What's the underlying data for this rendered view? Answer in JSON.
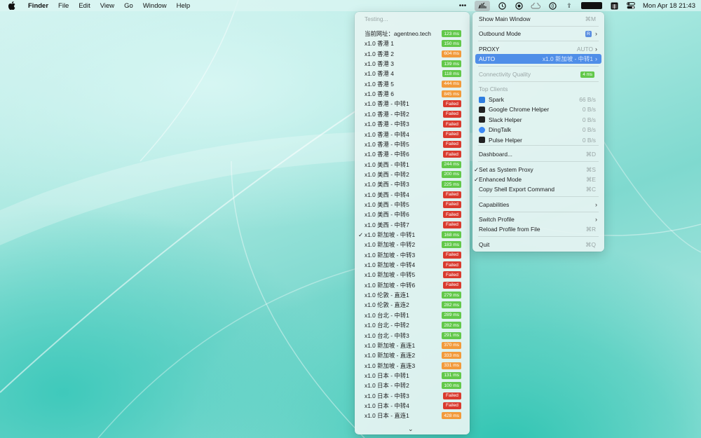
{
  "menubar": {
    "app_name": "Finder",
    "items": [
      "File",
      "Edit",
      "View",
      "Go",
      "Window",
      "Help"
    ],
    "clock": "Mon Apr 18  21:43"
  },
  "server_menu": {
    "header": "Testing...",
    "rows": [
      {
        "name": "当前网址：agentneo.tech",
        "latency": "123 ms",
        "status": "green"
      },
      {
        "name": "x1.0 香港 1",
        "latency": "150 ms",
        "status": "green"
      },
      {
        "name": "x1.0 香港 2",
        "latency": "604 ms",
        "status": "orange"
      },
      {
        "name": "x1.0 香港 3",
        "latency": "139 ms",
        "status": "green"
      },
      {
        "name": "x1.0 香港 4",
        "latency": "118 ms",
        "status": "green"
      },
      {
        "name": "x1.0 香港 5",
        "latency": "444 ms",
        "status": "orange"
      },
      {
        "name": "x1.0 香港 6",
        "latency": "845 ms",
        "status": "orange"
      },
      {
        "name": "x1.0 香港 - 中转1",
        "latency": "Failed",
        "status": "red"
      },
      {
        "name": "x1.0 香港 - 中转2",
        "latency": "Failed",
        "status": "red"
      },
      {
        "name": "x1.0 香港 - 中转3",
        "latency": "Failed",
        "status": "red"
      },
      {
        "name": "x1.0 香港 - 中转4",
        "latency": "Failed",
        "status": "red"
      },
      {
        "name": "x1.0 香港 - 中转5",
        "latency": "Failed",
        "status": "red"
      },
      {
        "name": "x1.0 香港 - 中转6",
        "latency": "Failed",
        "status": "red"
      },
      {
        "name": "x1.0 美西 - 中转1",
        "latency": "244 ms",
        "status": "green"
      },
      {
        "name": "x1.0 美西 - 中转2",
        "latency": "200 ms",
        "status": "green"
      },
      {
        "name": "x1.0 美西 - 中转3",
        "latency": "225 ms",
        "status": "green"
      },
      {
        "name": "x1.0 美西 - 中转4",
        "latency": "Failed",
        "status": "red"
      },
      {
        "name": "x1.0 美西 - 中转5",
        "latency": "Failed",
        "status": "red"
      },
      {
        "name": "x1.0 美西 - 中转6",
        "latency": "Failed",
        "status": "red"
      },
      {
        "name": "x1.0 美西 - 中转7",
        "latency": "Failed",
        "status": "red"
      },
      {
        "name": "x1.0 新加坡 - 中转1",
        "latency": "168 ms",
        "status": "green",
        "checked": true
      },
      {
        "name": "x1.0 新加坡 - 中转2",
        "latency": "183 ms",
        "status": "green"
      },
      {
        "name": "x1.0 新加坡 - 中转3",
        "latency": "Failed",
        "status": "red"
      },
      {
        "name": "x1.0 新加坡 - 中转4",
        "latency": "Failed",
        "status": "red"
      },
      {
        "name": "x1.0 新加坡 - 中转5",
        "latency": "Failed",
        "status": "red"
      },
      {
        "name": "x1.0 新加坡 - 中转6",
        "latency": "Failed",
        "status": "red"
      },
      {
        "name": "x1.0 伦敦 - 直连1",
        "latency": "279 ms",
        "status": "green"
      },
      {
        "name": "x1.0 伦敦 - 直连2",
        "latency": "282 ms",
        "status": "green"
      },
      {
        "name": "x1.0 台北 - 中转1",
        "latency": "289 ms",
        "status": "green"
      },
      {
        "name": "x1.0 台北 - 中转2",
        "latency": "282 ms",
        "status": "green"
      },
      {
        "name": "x1.0 台北 - 中转3",
        "latency": "291 ms",
        "status": "green"
      },
      {
        "name": "x1.0 新加坡 - 直连1",
        "latency": "370 ms",
        "status": "orange"
      },
      {
        "name": "x1.0 新加坡 - 直连2",
        "latency": "333 ms",
        "status": "orange"
      },
      {
        "name": "x1.0 新加坡 - 直连3",
        "latency": "331 ms",
        "status": "orange"
      },
      {
        "name": "x1.0 日本 - 中转1",
        "latency": "131 ms",
        "status": "green"
      },
      {
        "name": "x1.0 日本 - 中转2",
        "latency": "100 ms",
        "status": "green"
      },
      {
        "name": "x1.0 日本 - 中转3",
        "latency": "Failed",
        "status": "red"
      },
      {
        "name": "x1.0 日本 - 中转4",
        "latency": "Failed",
        "status": "red"
      },
      {
        "name": "x1.0 日本 - 直连1",
        "latency": "428 ms",
        "status": "orange"
      }
    ]
  },
  "main_menu": {
    "show_main_window": "Show Main Window",
    "show_main_window_sc": "⌘M",
    "outbound_mode": "Outbound Mode",
    "outbound_mode_badge": "R",
    "proxy": "PROXY",
    "proxy_value": "AUTO",
    "auto": "AUTO",
    "auto_value": "x1.0 新加坡 - 中转1",
    "connectivity": "Connectivity Quality",
    "connectivity_value": "4 ms",
    "top_clients": "Top Clients",
    "clients": [
      {
        "name": "Spark",
        "rate": "66 B/s",
        "icon": "app-blue"
      },
      {
        "name": "Google Chrome Helper",
        "rate": "0 B/s",
        "icon": "terminal"
      },
      {
        "name": "Slack Helper",
        "rate": "0 B/s",
        "icon": "terminal"
      },
      {
        "name": "DingTalk",
        "rate": "0 B/s",
        "icon": "ding"
      },
      {
        "name": "Pulse Helper",
        "rate": "0 B/s",
        "icon": "terminal"
      }
    ],
    "dashboard": "Dashboard...",
    "dashboard_sc": "⌘D",
    "set_system_proxy": "Set as System Proxy",
    "set_system_proxy_sc": "⌘S",
    "enhanced_mode": "Enhanced Mode",
    "enhanced_mode_sc": "⌘E",
    "copy_shell": "Copy Shell Export Command",
    "copy_shell_sc": "⌘C",
    "capabilities": "Capabilities",
    "switch_profile": "Switch Profile",
    "reload_profile": "Reload Profile from File",
    "reload_profile_sc": "⌘R",
    "quit": "Quit",
    "quit_sc": "⌘Q"
  }
}
